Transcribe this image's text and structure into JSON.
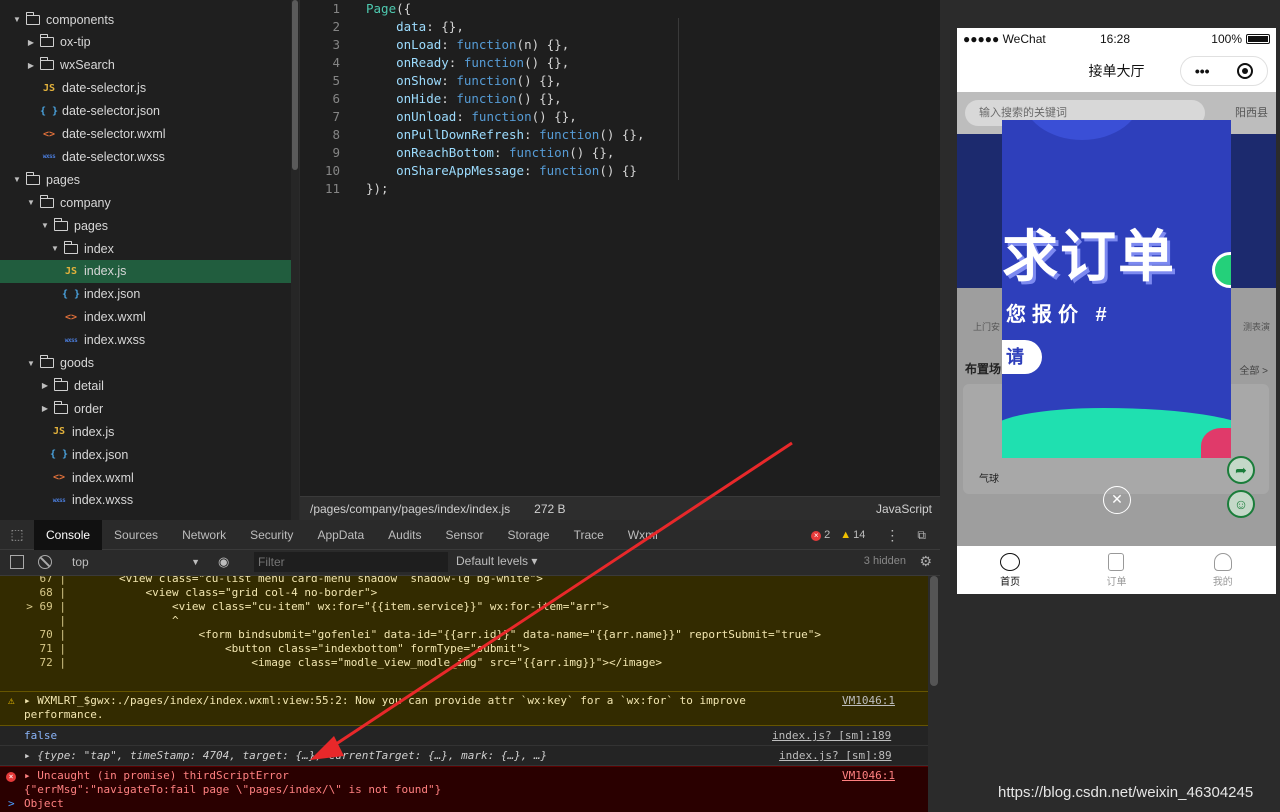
{
  "tree": {
    "items": [
      {
        "label": "components",
        "kind": "folder",
        "expanded": true,
        "depth": 1
      },
      {
        "label": "ox-tip",
        "kind": "folder",
        "expanded": false,
        "depth": 2
      },
      {
        "label": "wxSearch",
        "kind": "folder",
        "expanded": false,
        "depth": 2
      },
      {
        "label": "date-selector.js",
        "kind": "js",
        "depth": 3
      },
      {
        "label": "date-selector.json",
        "kind": "json",
        "depth": 3
      },
      {
        "label": "date-selector.wxml",
        "kind": "wxml",
        "depth": 3
      },
      {
        "label": "date-selector.wxss",
        "kind": "wxss",
        "depth": 3
      },
      {
        "label": "pages",
        "kind": "folder",
        "expanded": true,
        "depth": 1
      },
      {
        "label": "company",
        "kind": "folder",
        "expanded": true,
        "depth": 2
      },
      {
        "label": "pages",
        "kind": "folder",
        "expanded": true,
        "depth": 3
      },
      {
        "label": "index",
        "kind": "folder",
        "expanded": true,
        "depth": 4
      },
      {
        "label": "index.js",
        "kind": "js",
        "depth": 5,
        "selected": true
      },
      {
        "label": "index.json",
        "kind": "json",
        "depth": 5
      },
      {
        "label": "index.wxml",
        "kind": "wxml",
        "depth": 5
      },
      {
        "label": "index.wxss",
        "kind": "wxss",
        "depth": 5
      },
      {
        "label": "goods",
        "kind": "folder",
        "expanded": true,
        "depth": 2
      },
      {
        "label": "detail",
        "kind": "folder",
        "expanded": false,
        "depth": 3
      },
      {
        "label": "order",
        "kind": "folder",
        "expanded": false,
        "depth": 3
      },
      {
        "label": "index.js",
        "kind": "js",
        "depth": 4
      },
      {
        "label": "index.json",
        "kind": "json",
        "depth": 4
      },
      {
        "label": "index.wxml",
        "kind": "wxml",
        "depth": 4
      },
      {
        "label": "index.wxss",
        "kind": "wxss",
        "depth": 4
      }
    ],
    "icons": {
      "js": "JS",
      "json": "{ }",
      "wxml": "<>",
      "wxss": "wxss"
    }
  },
  "editor": {
    "lines": [
      {
        "n": "1",
        "code": "Page({"
      },
      {
        "n": "2",
        "code": "    data: {},"
      },
      {
        "n": "3",
        "code": "    onLoad: function(n) {},"
      },
      {
        "n": "4",
        "code": "    onReady: function() {},"
      },
      {
        "n": "5",
        "code": "    onShow: function() {},"
      },
      {
        "n": "6",
        "code": "    onHide: function() {},"
      },
      {
        "n": "7",
        "code": "    onUnload: function() {},"
      },
      {
        "n": "8",
        "code": "    onPullDownRefresh: function() {},"
      },
      {
        "n": "9",
        "code": "    onReachBottom: function() {},"
      },
      {
        "n": "10",
        "code": "    onShareAppMessage: function() {}"
      },
      {
        "n": "11",
        "code": "});"
      }
    ],
    "status": {
      "path": "/pages/company/pages/index/index.js",
      "size": "272 B",
      "language": "JavaScript"
    }
  },
  "simulator": {
    "carrier": "●●●●● WeChat",
    "time": "16:28",
    "battery": "100%",
    "title": "接单大厅",
    "capsule_more": "•••",
    "search_placeholder": "输入搜索的关键词",
    "region": "阳西县",
    "popup_big": "求订单",
    "popup_sub": "您报价 #",
    "popup_btn": "请",
    "label_left": "上门安",
    "label_right": "测表演",
    "section_title": "布置场",
    "section_more": "全部 >",
    "card_label": "气球",
    "close_icon": "✕",
    "tabs": [
      {
        "label": "首页",
        "active": true
      },
      {
        "label": "订单",
        "active": false
      },
      {
        "label": "我的",
        "active": false
      }
    ]
  },
  "devtools": {
    "tabs": [
      "Console",
      "Sources",
      "Network",
      "Security",
      "AppData",
      "Audits",
      "Sensor",
      "Storage",
      "Trace",
      "Wxml"
    ],
    "active_tab": "Console",
    "error_count": "2",
    "warning_count": "14",
    "context": "top",
    "filter_placeholder": "Filter",
    "levels": "Default levels",
    "hidden": "3 hidden",
    "source_lines": [
      {
        "no": "67 |",
        "txt": "        <view class=\"cu-list menu card-menu shadow  shadow-lg bg-white\">"
      },
      {
        "no": "68 |",
        "txt": "            <view class=\"grid col-4 no-border\">"
      },
      {
        "no": "> 69 |",
        "txt": "                <view class=\"cu-item\" wx:for=\"{{item.service}}\" wx:for-item=\"arr\">"
      },
      {
        "no": "|",
        "txt": "                ^"
      },
      {
        "no": "70 |",
        "txt": "                    <form bindsubmit=\"gofenlei\" data-id=\"{{arr.id}}\" data-name=\"{{arr.name}}\" reportSubmit=\"true\">"
      },
      {
        "no": "71 |",
        "txt": "                        <button class=\"indexbottom\" formType=\"submit\">"
      },
      {
        "no": "72 |",
        "txt": "                            <image class=\"modle_view_modle_img\" src=\"{{arr.img}}\"></image>"
      }
    ],
    "warn_line1": "▸ WXMLRT_$gwx:./pages/index/index.wxml:view:55:2: Now you can provide attr `wx:key` for a `wx:for` to improve",
    "warn_line2": "performance.",
    "warn_link": "VM1046:1",
    "false_text": "false",
    "false_link": "index.js? [sm]:189",
    "obj_text": "▸ {type: \"tap\", timeStamp: 4704, target: {…}, currentTarget: {…}, mark: {…}, …}",
    "obj_link": "index.js? [sm]:89",
    "err_line1": "▸ Uncaught (in promise) thirdScriptError",
    "err_line2": "{\"errMsg\":\"navigateTo:fail page \\\"pages/index/\\\" is not found\"}",
    "err_line3": "Object",
    "err_link": "VM1046:1",
    "prompt": ">"
  },
  "watermark": "https://blog.csdn.net/weixin_46304245",
  "colors": {
    "selected_row": "#215d3e",
    "annotation_arrow": "#e8282a",
    "error_bg": "#2a0000",
    "warning_bg": "#332b00"
  }
}
